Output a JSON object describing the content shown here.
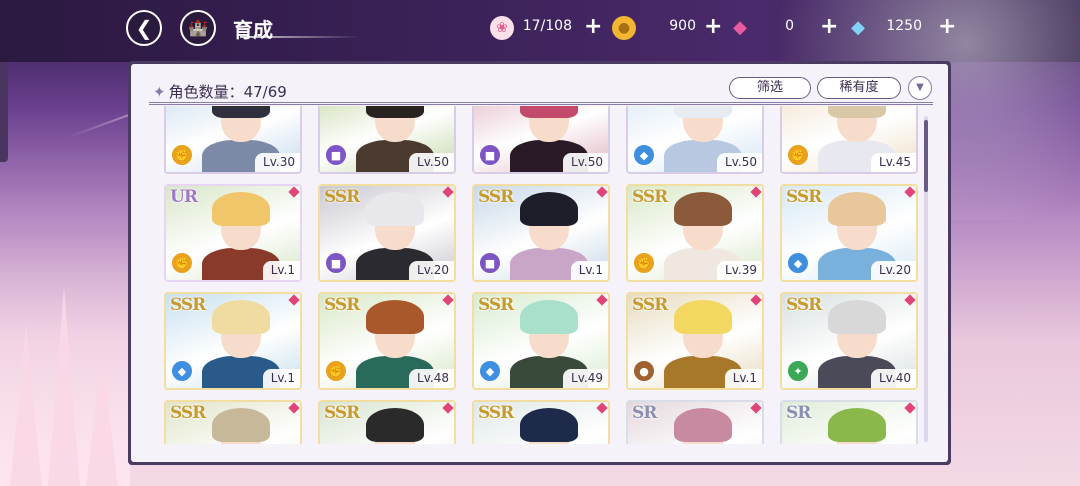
{
  "header": {
    "title": "育成",
    "back_icon": "back-arrow-icon",
    "home_icon": "castle-home-icon"
  },
  "resources": [
    {
      "name": "candy",
      "icon": "candy-icon",
      "value": "17/108",
      "color": "#f29ab5"
    },
    {
      "name": "gold",
      "icon": "gold-coin-icon",
      "value": "900",
      "color": "#f2b632"
    },
    {
      "name": "pink-gem",
      "icon": "pink-gem-icon",
      "value": "0",
      "color": "#e95aa0"
    },
    {
      "name": "blue-gem",
      "icon": "blue-diamond-icon",
      "value": "1250",
      "color": "#7fd3f5"
    }
  ],
  "panel": {
    "count_label": "角色数量：47/69",
    "filter_label": "筛选",
    "rarity_sort_label": "稀有度",
    "dropdown_icon": "chevron-down-icon"
  },
  "characters": [
    {
      "rarity": "",
      "level": "Lv.30",
      "class": "gold",
      "palette": [
        "#c9dcef",
        "#2f2f3e",
        "#7c8aa8"
      ]
    },
    {
      "rarity": "",
      "level": "Lv.50",
      "class": "purple",
      "palette": [
        "#c6d8a8",
        "#2a2420",
        "#4a3a30"
      ]
    },
    {
      "rarity": "",
      "level": "Lv.50",
      "class": "purple",
      "palette": [
        "#e0b6c2",
        "#c24a6a",
        "#2a1a28"
      ]
    },
    {
      "rarity": "",
      "level": "Lv.50",
      "class": "blue",
      "palette": [
        "#d6e6f4",
        "#e7ecf2",
        "#b8c8e0"
      ]
    },
    {
      "rarity": "",
      "level": "Lv.45",
      "class": "gold",
      "palette": [
        "#f0e0c8",
        "#d8c8a8",
        "#e8e8f0"
      ]
    },
    {
      "rarity": "UR",
      "level": "Lv.1",
      "class": "gold",
      "palette": [
        "#d9e6c8",
        "#f1c66a",
        "#8a3a2a"
      ]
    },
    {
      "rarity": "SSR",
      "level": "Lv.20",
      "class": "purple",
      "palette": [
        "#c8c8d0",
        "#e8e8ec",
        "#2a2a30"
      ]
    },
    {
      "rarity": "SSR",
      "level": "Lv.1",
      "class": "purple",
      "palette": [
        "#c8d8e8",
        "#1e1e2a",
        "#c9a6c8"
      ]
    },
    {
      "rarity": "SSR",
      "level": "Lv.39",
      "class": "gold",
      "palette": [
        "#d8e8c8",
        "#8a5a3a",
        "#f0e8e0"
      ]
    },
    {
      "rarity": "SSR",
      "level": "Lv.20",
      "class": "blue",
      "palette": [
        "#d6e8f4",
        "#e8c89a",
        "#7ab0dc"
      ]
    },
    {
      "rarity": "SSR",
      "level": "Lv.1",
      "class": "blue",
      "palette": [
        "#c8e0f0",
        "#f0dca0",
        "#2a5a8a"
      ]
    },
    {
      "rarity": "SSR",
      "level": "Lv.48",
      "class": "gold",
      "palette": [
        "#d8e8c8",
        "#a8582a",
        "#2a6a5a"
      ]
    },
    {
      "rarity": "SSR",
      "level": "Lv.49",
      "class": "blue",
      "palette": [
        "#d8ecd0",
        "#a8e0cc",
        "#3a4a3a"
      ]
    },
    {
      "rarity": "SSR",
      "level": "Lv.1",
      "class": "brown",
      "palette": [
        "#e8dcc0",
        "#f2d860",
        "#a8782a"
      ]
    },
    {
      "rarity": "SSR",
      "level": "Lv.40",
      "class": "green",
      "palette": [
        "#d8e0e0",
        "#d8d8d8",
        "#4a4a58"
      ]
    },
    {
      "rarity": "SSR",
      "level": "",
      "class": "",
      "palette": [
        "#e0e4c8",
        "#c8b89a",
        "#8a8a6a"
      ]
    },
    {
      "rarity": "SSR",
      "level": "",
      "class": "",
      "palette": [
        "#d8e4d0",
        "#2a2a2a",
        "#2a6a4a"
      ]
    },
    {
      "rarity": "SSR",
      "level": "",
      "class": "",
      "palette": [
        "#e0e8e8",
        "#1e2a4a",
        "#e8e0c8"
      ]
    },
    {
      "rarity": "SR",
      "level": "",
      "class": "",
      "palette": [
        "#e4d8dc",
        "#c88aa0",
        "#e8c0c8"
      ]
    },
    {
      "rarity": "SR",
      "level": "",
      "class": "",
      "palette": [
        "#e0ecd8",
        "#8ab84a",
        "#e0e8d0"
      ]
    }
  ],
  "class_colors": {
    "gold": "#e9a21c",
    "purple": "#7d55c4",
    "blue": "#3f8fe0",
    "brown": "#a0622e",
    "green": "#3aa857"
  }
}
